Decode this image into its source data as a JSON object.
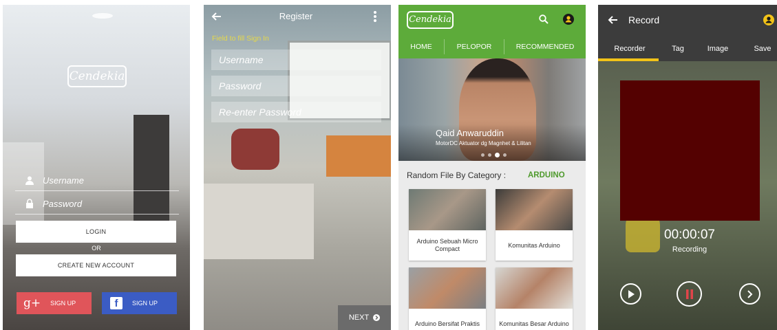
{
  "login": {
    "logo_text": "Cendekia",
    "username_placeholder": "Username",
    "password_placeholder": "Password",
    "login_label": "LOGIN",
    "or_label": "OR",
    "create_account_label": "CREATE NEW ACCOUNT",
    "google_label": "SIGN UP",
    "google_glyph": "g+",
    "facebook_label": "SIGN UP",
    "facebook_glyph": "f",
    "colors": {
      "google": "#e0555a",
      "facebook": "#3b5cc4"
    }
  },
  "register": {
    "title": "Register",
    "hint": "Field to fill Sign In",
    "username_placeholder": "Username",
    "password_placeholder": "Password",
    "reenter_placeholder": "Re-enter Password",
    "next_label": "NEXT",
    "hint_color": "#e5d84a"
  },
  "home": {
    "logo_text": "Cendekia",
    "tabs": [
      {
        "label": "HOME"
      },
      {
        "label": "PELOPOR"
      },
      {
        "label": "RECOMMENDED"
      }
    ],
    "hero": {
      "name": "Qaid Anwaruddin",
      "subtitle": "MotorDC Aktuator dg Magnhet & Lilitan"
    },
    "section_title": "Random File By Category :",
    "category": "ARDUINO",
    "cards": [
      {
        "caption": "Arduino Sebuah Micro Compact"
      },
      {
        "caption": "Komunitas Arduino"
      },
      {
        "caption": "Arduino Bersifat Praktis"
      },
      {
        "caption": "Komunitas Besar Arduino"
      }
    ],
    "accent": "#5dab3a"
  },
  "record": {
    "title": "Record",
    "tabs": [
      {
        "label": "Recorder"
      },
      {
        "label": "Tag"
      },
      {
        "label": "Image"
      },
      {
        "label": "Save"
      }
    ],
    "timer": "00:00:07",
    "status": "Recording",
    "indicator_color": "#f2c318",
    "preview_color": "#540101"
  }
}
